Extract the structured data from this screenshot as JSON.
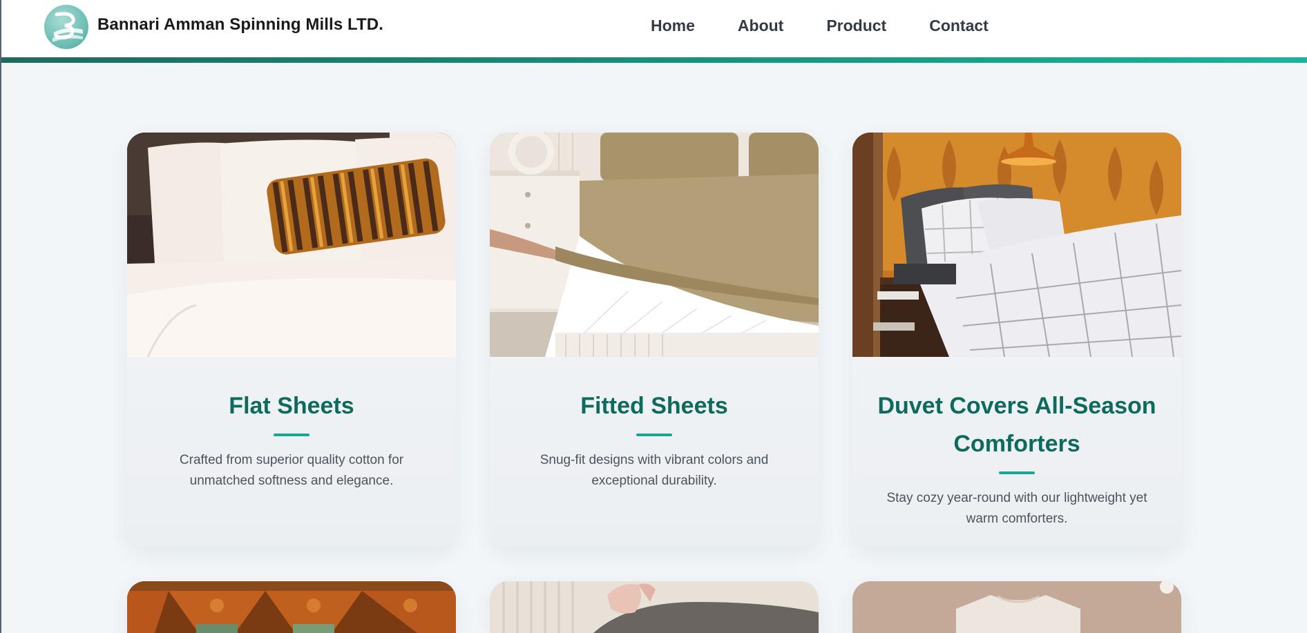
{
  "header": {
    "brand": "Bannari Amman Spinning Mills LTD.",
    "nav": [
      "Home",
      "About",
      "Product",
      "Contact"
    ]
  },
  "colors": {
    "accent": "#0e6a5c",
    "accent_light": "#18a892",
    "background": "#f2f6f9"
  },
  "products": [
    {
      "title": "Flat Sheets",
      "description": "Crafted from superior quality cotton for unmatched softness and elegance.",
      "image": "bed-with-striped-pillow-image"
    },
    {
      "title": "Fitted Sheets",
      "description": "Snug-fit designs with vibrant colors and exceptional durability.",
      "image": "fitted-sheet-on-mattress-image"
    },
    {
      "title": "Duvet Covers All-Season Comforters",
      "description": "Stay cozy year-round with our lightweight yet warm comforters.",
      "image": "duvet-bedroom-image"
    },
    {
      "image": "curtains-image"
    },
    {
      "image": "pillow-cover-image"
    },
    {
      "image": "kids-tshirt-image"
    }
  ]
}
